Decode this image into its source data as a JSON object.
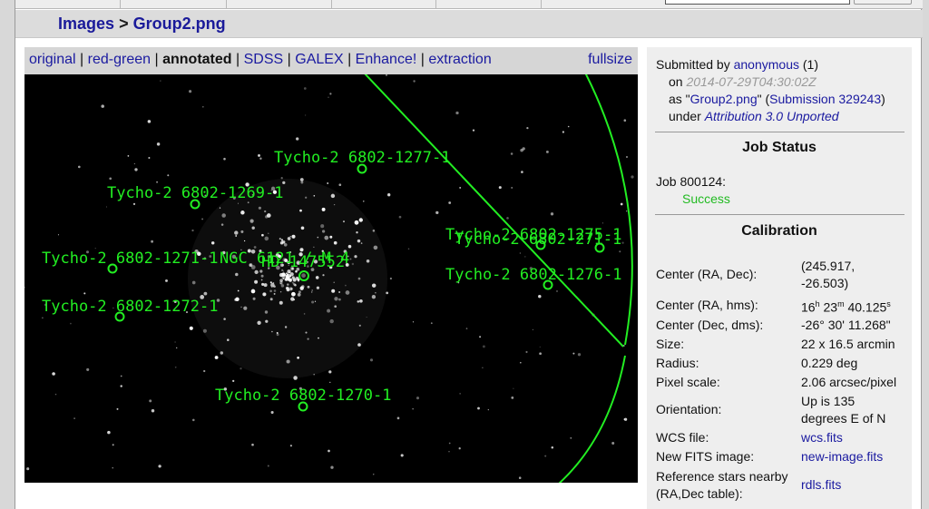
{
  "breadcrumb": {
    "images_label": "Images",
    "separator": ">",
    "file_label": "Group2.png"
  },
  "image_tabs": {
    "items": [
      "original",
      "red-green",
      "annotated",
      "SDSS",
      "GALEX",
      "Enhance!",
      "extraction"
    ],
    "active": "annotated",
    "fullsize_label": "fullsize"
  },
  "annotations": [
    {
      "label": "Tycho-2 6802-1277-1"
    },
    {
      "label": "Tycho-2 6802-1269-1"
    },
    {
      "label": "Tycho-2 6802-1271-1"
    },
    {
      "label": "NGC 6121 / M 4"
    },
    {
      "label": "HD 147552"
    },
    {
      "label": "Tycho-2 6802-1272-1"
    },
    {
      "label": "Tycho-2 6802-1275-1"
    },
    {
      "label": "Tycho-2 6802-271-1"
    },
    {
      "label": "Tycho-2 6802-1276-1"
    },
    {
      "label": "Tycho-2 6802-1270-1"
    }
  ],
  "submission": {
    "submitted_by_prefix": "Submitted by",
    "user": "anonymous",
    "user_count": "(1)",
    "on_prefix": "on",
    "date": "2014-07-29T04:30:02Z",
    "as_prefix": "as \"",
    "filename": "Group2.png",
    "as_mid": "\" (",
    "submission_link": "Submission 329243",
    "as_suffix": ")",
    "under_prefix": "under",
    "license": "Attribution 3.0 Unported"
  },
  "job_status": {
    "title": "Job Status",
    "job_label": "Job 800124:",
    "status": "Success"
  },
  "calibration": {
    "title": "Calibration",
    "center_radec_label": "Center (RA, Dec):",
    "center_radec_line1": "(245.917,",
    "center_radec_line2": "-26.503)",
    "center_hms_label": "Center (RA, hms):",
    "ra_h": "16",
    "ra_h_unit": "h",
    "ra_m": " 23",
    "ra_m_unit": "m",
    "ra_s": " 40.125",
    "ra_s_unit": "s",
    "center_dms_label": "Center (Dec, dms):",
    "center_dms_value": "-26° 30' 11.268\"",
    "size_label": "Size:",
    "size_value": "22 x 16.5 arcmin",
    "radius_label": "Radius:",
    "radius_value": "0.229 deg",
    "pixel_scale_label": "Pixel scale:",
    "pixel_scale_value": "2.06 arcsec/pixel",
    "orientation_label": "Orientation:",
    "orientation_line1": "Up is 135",
    "orientation_line2": "degrees E of N",
    "wcs_label": "WCS file:",
    "wcs_value": "wcs.fits",
    "new_fits_label": "New FITS image:",
    "new_fits_value": "new-image.fits",
    "ref_stars_label_line1": "Reference stars nearby",
    "ref_stars_label_line2": "(RA,Dec table):",
    "ref_stars_value": "rdls.fits"
  },
  "colors": {
    "annotation": "#22ee22",
    "link": "#1a1aa0",
    "success": "#22bb22"
  }
}
